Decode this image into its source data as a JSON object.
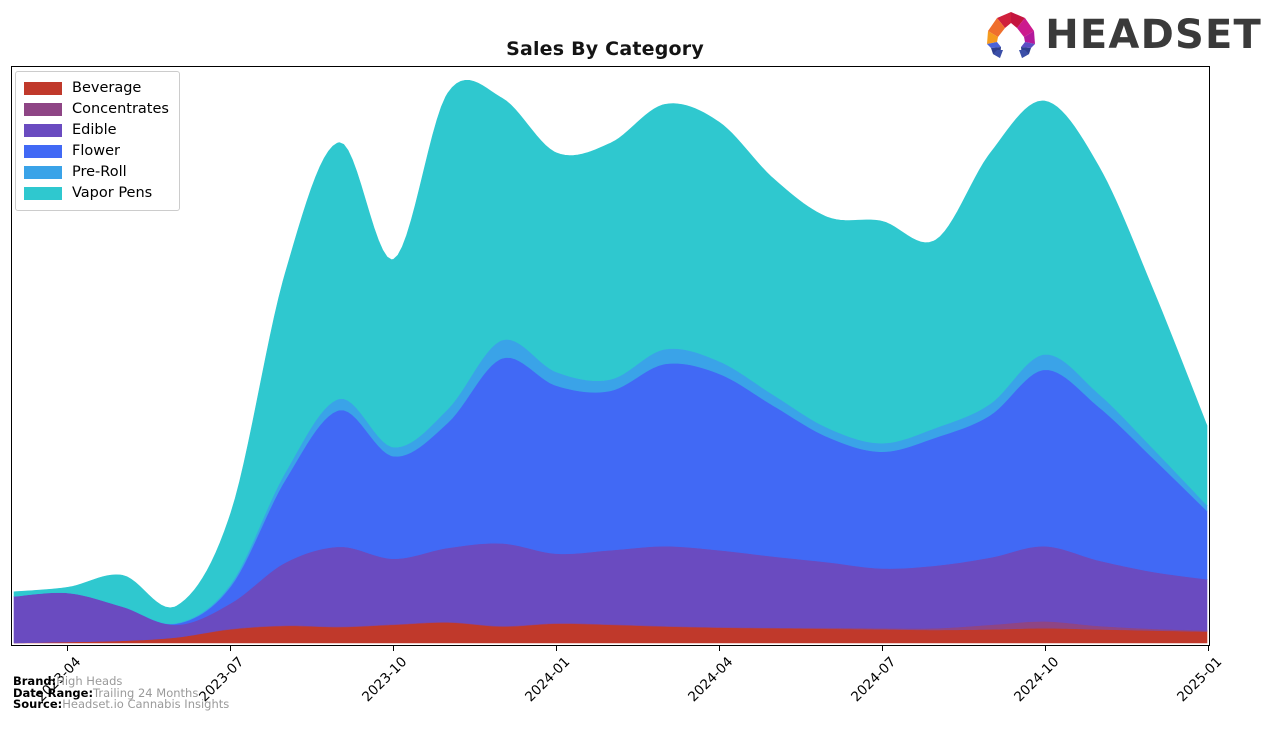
{
  "header": {
    "title": "Sales By Category",
    "logo_text": "HEADSET",
    "logo_mark_name": "headset-ring-logo"
  },
  "legend": {
    "position": "top-left",
    "items": [
      {
        "label": "Beverage",
        "color": "#c0392b"
      },
      {
        "label": "Concentrates",
        "color": "#8e4585"
      },
      {
        "label": "Edible",
        "color": "#6a4bc0"
      },
      {
        "label": "Flower",
        "color": "#4169f5"
      },
      {
        "label": "Pre-Roll",
        "color": "#3aa3e8"
      },
      {
        "label": "Vapor Pens",
        "color": "#2fc8cf"
      }
    ]
  },
  "footer": {
    "lines": [
      {
        "key": "Brand:",
        "value": "High Heads"
      },
      {
        "key": "Date Range:",
        "value": "Trailing 24 Months"
      },
      {
        "key": "Source:",
        "value": "Headset.io Cannabis Insights"
      }
    ]
  },
  "axis": {
    "x_ticks": [
      "2023-04",
      "2023-07",
      "2023-10",
      "2024-01",
      "2024-04",
      "2024-07",
      "2024-10",
      "2025-01"
    ],
    "y_ticks": [],
    "grid": false
  },
  "chart_data": {
    "type": "area",
    "stacked": true,
    "title": "Sales By Category",
    "xlabel": "",
    "ylabel": "",
    "legend_position": "top-left",
    "x": [
      "2023-03",
      "2023-04",
      "2023-05",
      "2023-06",
      "2023-07",
      "2023-08",
      "2023-09",
      "2023-10",
      "2023-11",
      "2023-12",
      "2024-01",
      "2024-02",
      "2024-03",
      "2024-04",
      "2024-05",
      "2024-06",
      "2024-07",
      "2024-08",
      "2024-09",
      "2024-10",
      "2024-11",
      "2024-12",
      "2025-01"
    ],
    "x_tick_labels": [
      "2023-04",
      "2023-07",
      "2023-10",
      "2024-01",
      "2024-04",
      "2024-07",
      "2024-10",
      "2025-01"
    ],
    "ylim": [
      0,
      100
    ],
    "series": [
      {
        "name": "Beverage",
        "color": "#c0392b",
        "values": [
          0.0,
          0.2,
          0.4,
          1.0,
          2.4,
          3.0,
          2.8,
          3.2,
          3.6,
          2.9,
          3.4,
          3.2,
          2.9,
          2.7,
          2.6,
          2.5,
          2.4,
          2.3,
          2.4,
          2.6,
          2.4,
          2.2,
          2.0
        ]
      },
      {
        "name": "Concentrates",
        "color": "#8e4585",
        "values": [
          0.0,
          0.0,
          0.0,
          0.0,
          0.1,
          0.1,
          0.1,
          0.1,
          0.1,
          0.1,
          0.1,
          0.1,
          0.1,
          0.1,
          0.1,
          0.2,
          0.2,
          0.3,
          0.8,
          1.2,
          0.6,
          0.3,
          0.2
        ]
      },
      {
        "name": "Edible",
        "color": "#6a4bc0",
        "values": [
          8.2,
          8.6,
          6.0,
          2.2,
          4.5,
          11.0,
          14.0,
          11.5,
          13.0,
          14.5,
          12.2,
          13.0,
          14.0,
          13.5,
          12.5,
          11.5,
          10.5,
          11.0,
          11.8,
          13.2,
          11.5,
          10.0,
          9.0
        ]
      },
      {
        "name": "Flower",
        "color": "#4169f5",
        "values": [
          0.0,
          0.0,
          0.0,
          0.2,
          3.0,
          14.5,
          24.0,
          18.0,
          22.0,
          32.5,
          29.5,
          28.0,
          32.0,
          31.0,
          26.5,
          22.0,
          20.5,
          22.5,
          25.0,
          31.0,
          27.0,
          20.0,
          12.0
        ]
      },
      {
        "name": "Pre-Roll",
        "color": "#3aa3e8",
        "values": [
          0.0,
          0.0,
          0.0,
          0.1,
          0.4,
          1.3,
          2.0,
          1.6,
          2.4,
          3.2,
          2.4,
          2.0,
          2.6,
          2.2,
          1.9,
          1.6,
          1.5,
          1.7,
          2.0,
          2.7,
          2.3,
          1.7,
          1.0
        ]
      },
      {
        "name": "Vapor Pens",
        "color": "#2fc8cf",
        "values": [
          0.8,
          1.0,
          5.5,
          3.0,
          12.5,
          35.0,
          45.0,
          33.0,
          55.5,
          42.5,
          38.5,
          41.5,
          43.0,
          42.0,
          38.0,
          37.0,
          39.0,
          33.0,
          44.0,
          44.5,
          40.0,
          28.0,
          14.0
        ]
      }
    ]
  }
}
